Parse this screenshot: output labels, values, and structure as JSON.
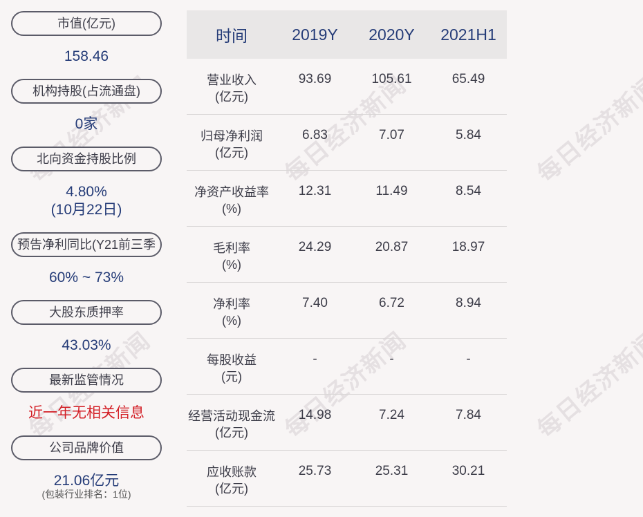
{
  "left_panel": [
    {
      "label": "市值(亿元)",
      "value": "158.46"
    },
    {
      "label": "机构持股(占流通盘)",
      "value": "0家"
    },
    {
      "label": "北向资金持股比例",
      "value": "4.80%",
      "value2": "(10月22日)"
    },
    {
      "label": "预告净利同比(Y21前三季",
      "value": "60% ~ 73%"
    },
    {
      "label": "大股东质押率",
      "value": "43.03%"
    },
    {
      "label": "最新监管情况",
      "value": "近一年无相关信息",
      "value_color": "#d31f26"
    },
    {
      "label": "公司品牌价值",
      "value": "21.06亿元",
      "note": "(包装行业排名：1位)"
    }
  ],
  "table": {
    "headers": [
      "时间",
      "2019Y",
      "2020Y",
      "2021H1"
    ],
    "rows": [
      {
        "label": "营业收入",
        "unit": "(亿元)",
        "values": [
          "93.69",
          "105.61",
          "65.49"
        ]
      },
      {
        "label": "归母净利润",
        "unit": "(亿元)",
        "values": [
          "6.83",
          "7.07",
          "5.84"
        ]
      },
      {
        "label": "净资产收益率",
        "unit": "(%)",
        "values": [
          "12.31",
          "11.49",
          "8.54"
        ]
      },
      {
        "label": "毛利率",
        "unit": "(%)",
        "values": [
          "24.29",
          "20.87",
          "18.97"
        ]
      },
      {
        "label": "净利率",
        "unit": "(%)",
        "values": [
          "7.40",
          "6.72",
          "8.94"
        ]
      },
      {
        "label": "每股收益",
        "unit": "(元)",
        "values": [
          "-",
          "-",
          "-"
        ]
      },
      {
        "label": "经营活动现金流",
        "unit": "(亿元)",
        "values": [
          "14.98",
          "7.24",
          "7.84"
        ]
      },
      {
        "label": "应收账款",
        "unit": "(亿元)",
        "values": [
          "25.73",
          "25.31",
          "30.21"
        ]
      }
    ]
  },
  "watermark": "每日经济新闻"
}
